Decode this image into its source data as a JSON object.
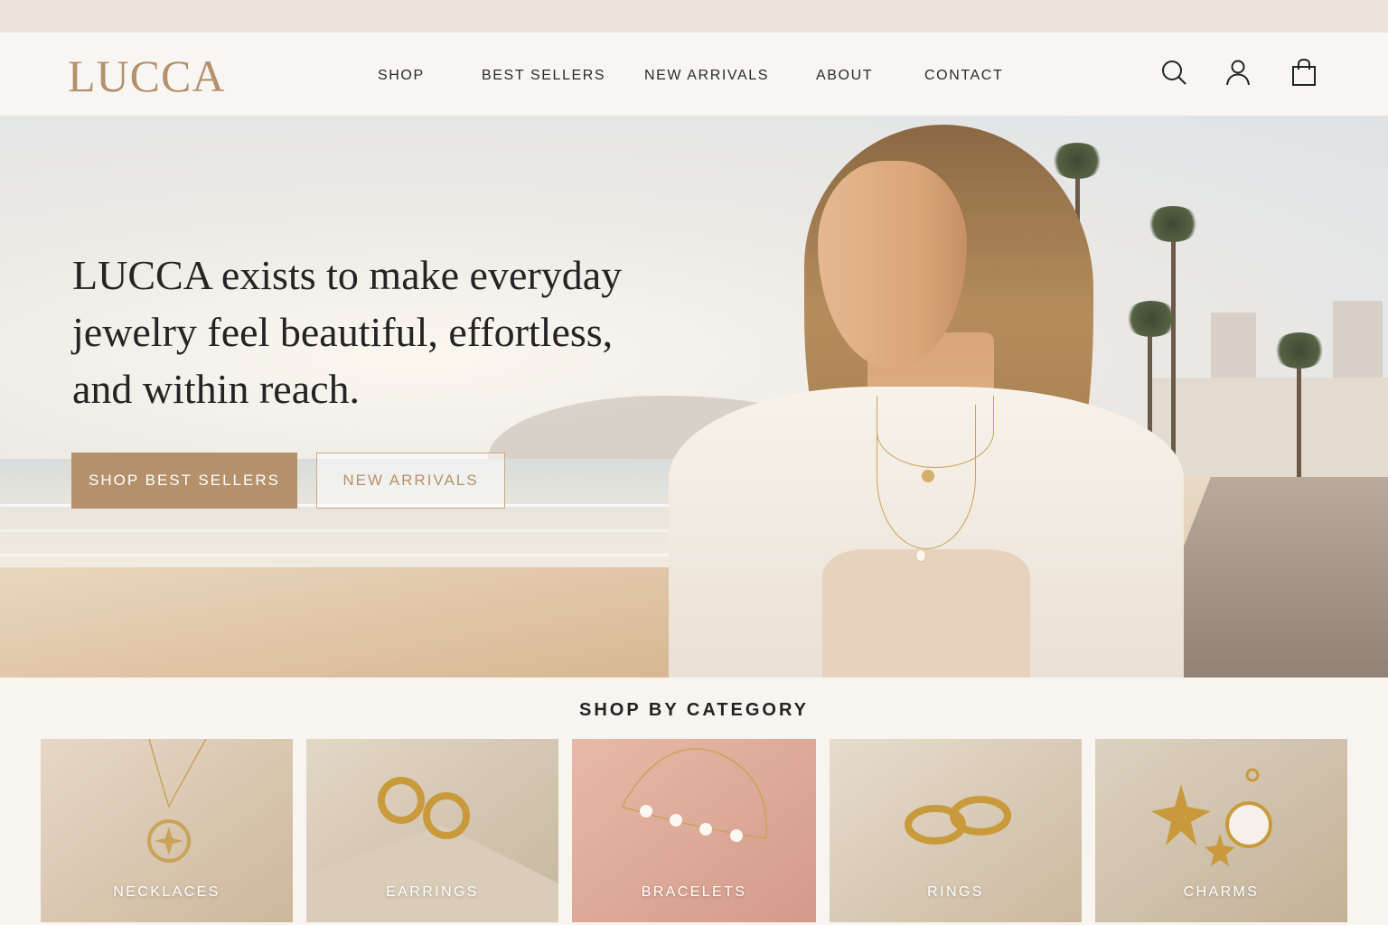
{
  "brand": {
    "logo": "LUCCA",
    "accent_color": "#b4916a"
  },
  "nav": {
    "items": [
      {
        "label": "SHOP"
      },
      {
        "label": "BEST SELLERS"
      },
      {
        "label": "NEW ARRIVALS"
      },
      {
        "label": "ABOUT"
      },
      {
        "label": "CONTACT"
      }
    ],
    "icons": [
      "search-icon",
      "account-icon",
      "shopping-bag-icon"
    ]
  },
  "hero": {
    "headline": "LUCCA exists to make everyday jewelry feel beautiful, effortless, and within reach.",
    "primary_button": "SHOP BEST SELLERS",
    "secondary_button": "NEW ARRIVALS"
  },
  "categories": {
    "title": "SHOP BY CATEGORY",
    "items": [
      {
        "label": "NECKLACES"
      },
      {
        "label": "EARRINGS"
      },
      {
        "label": "BRACELETS"
      },
      {
        "label": "RINGS"
      },
      {
        "label": "CHARMS"
      }
    ]
  }
}
